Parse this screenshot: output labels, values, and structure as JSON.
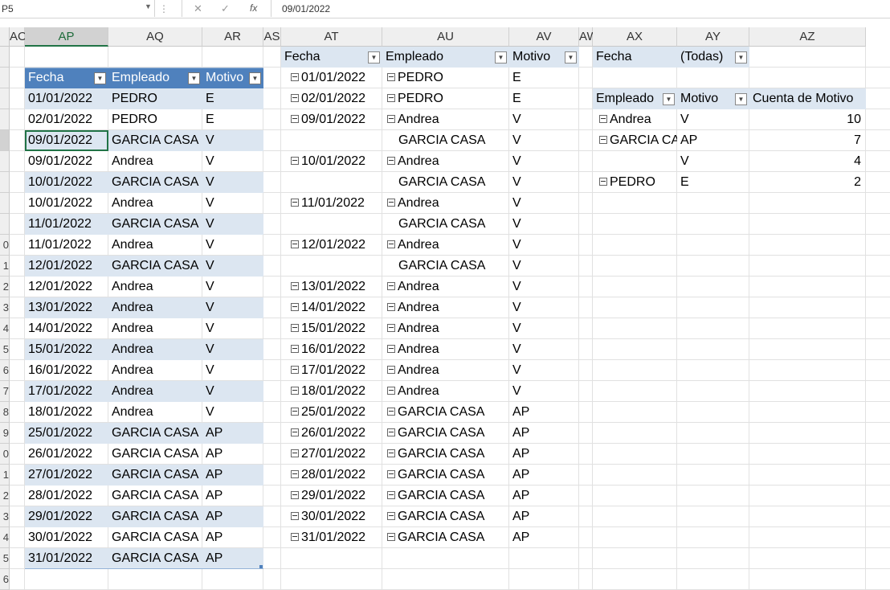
{
  "formula_bar": {
    "name_box": "P5",
    "formula": "09/01/2022",
    "fx_label": "fx"
  },
  "column_headers": [
    "AO",
    "AP",
    "AQ",
    "AR",
    "AS",
    "AT",
    "AU",
    "AV",
    "AW",
    "AX",
    "AY",
    "AZ"
  ],
  "row_headers": [
    "",
    "",
    "",
    "",
    "",
    "",
    "",
    "",
    "",
    "0",
    "1",
    "2",
    "3",
    "4",
    "5",
    "6",
    "7",
    "8",
    "9",
    "0",
    "1",
    "2",
    "3",
    "4",
    "5",
    "6"
  ],
  "source_table": {
    "headers": [
      "Fecha",
      "Empleado",
      "Motivo"
    ],
    "rows": [
      [
        "01/01/2022",
        "PEDRO",
        "E"
      ],
      [
        "02/01/2022",
        "PEDRO",
        "E"
      ],
      [
        "09/01/2022",
        "GARCIA CASA",
        "V"
      ],
      [
        "09/01/2022",
        "Andrea",
        "V"
      ],
      [
        "10/01/2022",
        "GARCIA CASA",
        "V"
      ],
      [
        "10/01/2022",
        "Andrea",
        "V"
      ],
      [
        "11/01/2022",
        "GARCIA CASA",
        "V"
      ],
      [
        "11/01/2022",
        "Andrea",
        "V"
      ],
      [
        "12/01/2022",
        "GARCIA CASA",
        "V"
      ],
      [
        "12/01/2022",
        "Andrea",
        "V"
      ],
      [
        "13/01/2022",
        "Andrea",
        "V"
      ],
      [
        "14/01/2022",
        "Andrea",
        "V"
      ],
      [
        "15/01/2022",
        "Andrea",
        "V"
      ],
      [
        "16/01/2022",
        "Andrea",
        "V"
      ],
      [
        "17/01/2022",
        "Andrea",
        "V"
      ],
      [
        "18/01/2022",
        "Andrea",
        "V"
      ],
      [
        "25/01/2022",
        "GARCIA CASA",
        "AP"
      ],
      [
        "26/01/2022",
        "GARCIA CASA",
        "AP"
      ],
      [
        "27/01/2022",
        "GARCIA CASA",
        "AP"
      ],
      [
        "28/01/2022",
        "GARCIA CASA",
        "AP"
      ],
      [
        "29/01/2022",
        "GARCIA CASA",
        "AP"
      ],
      [
        "30/01/2022",
        "GARCIA CASA",
        "AP"
      ],
      [
        "31/01/2022",
        "GARCIA CASA",
        "AP"
      ]
    ]
  },
  "pivot1": {
    "headers": [
      "Fecha",
      "Empleado",
      "Motivo"
    ],
    "rows": [
      [
        "01/01/2022",
        "PEDRO",
        "E"
      ],
      [
        "02/01/2022",
        "PEDRO",
        "E"
      ],
      [
        "09/01/2022",
        "Andrea",
        "V"
      ],
      [
        "",
        "GARCIA CASA",
        "V"
      ],
      [
        "10/01/2022",
        "Andrea",
        "V"
      ],
      [
        "",
        "GARCIA CASA",
        "V"
      ],
      [
        "11/01/2022",
        "Andrea",
        "V"
      ],
      [
        "",
        "GARCIA CASA",
        "V"
      ],
      [
        "12/01/2022",
        "Andrea",
        "V"
      ],
      [
        "",
        "GARCIA CASA",
        "V"
      ],
      [
        "13/01/2022",
        "Andrea",
        "V"
      ],
      [
        "14/01/2022",
        "Andrea",
        "V"
      ],
      [
        "15/01/2022",
        "Andrea",
        "V"
      ],
      [
        "16/01/2022",
        "Andrea",
        "V"
      ],
      [
        "17/01/2022",
        "Andrea",
        "V"
      ],
      [
        "18/01/2022",
        "Andrea",
        "V"
      ],
      [
        "25/01/2022",
        "GARCIA CASA",
        "AP"
      ],
      [
        "26/01/2022",
        "GARCIA CASA",
        "AP"
      ],
      [
        "27/01/2022",
        "GARCIA CASA",
        "AP"
      ],
      [
        "28/01/2022",
        "GARCIA CASA",
        "AP"
      ],
      [
        "29/01/2022",
        "GARCIA CASA",
        "AP"
      ],
      [
        "30/01/2022",
        "GARCIA CASA",
        "AP"
      ],
      [
        "31/01/2022",
        "GARCIA CASA",
        "AP"
      ]
    ]
  },
  "pivot2": {
    "filter_label": "Fecha",
    "filter_value": "(Todas)",
    "headers": [
      "Empleado",
      "Motivo",
      "Cuenta de Motivo"
    ],
    "rows": [
      [
        "Andrea",
        "V",
        "10"
      ],
      [
        "GARCIA CASA",
        "AP",
        "7"
      ],
      [
        "",
        "V",
        "4"
      ],
      [
        "PEDRO",
        "E",
        "2"
      ]
    ]
  }
}
